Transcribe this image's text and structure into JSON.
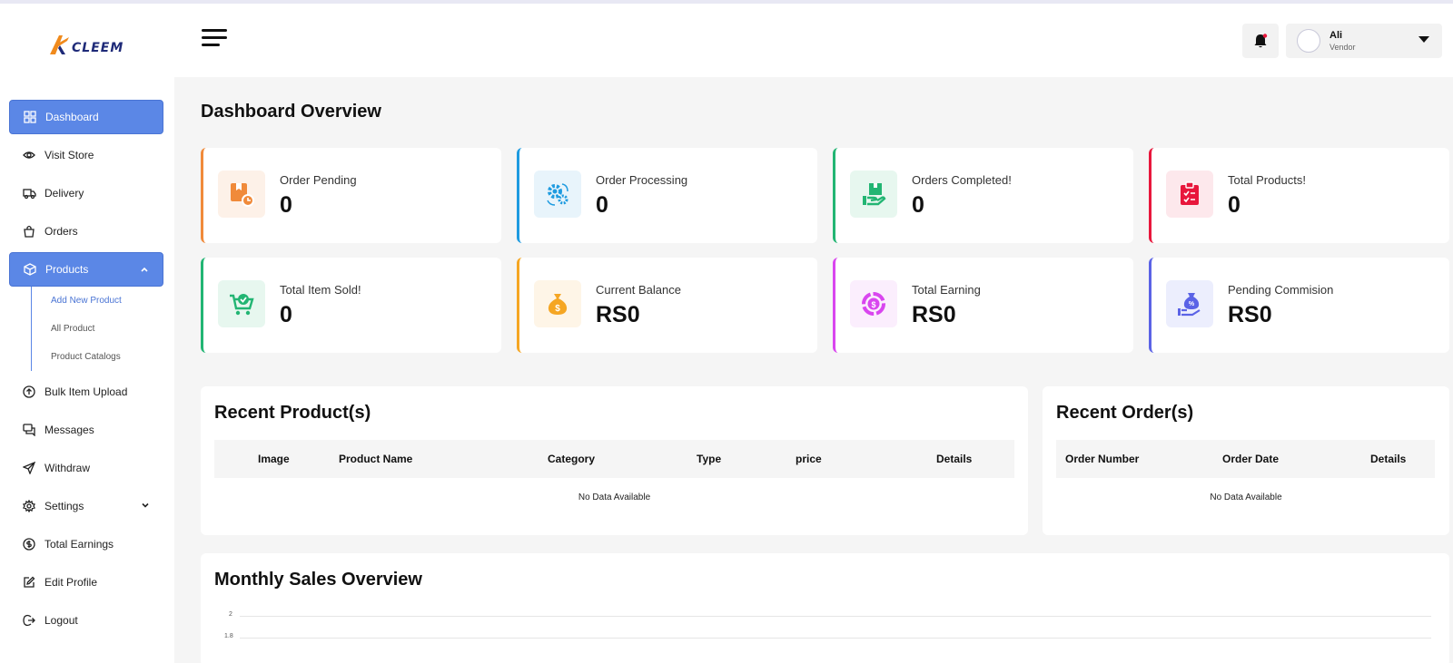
{
  "brand": {
    "logo_text": "CLEEM",
    "accent": "#5b87e6"
  },
  "sidebar": {
    "items": [
      {
        "label": "Dashboard",
        "icon": "grid-icon",
        "active": true
      },
      {
        "label": "Visit Store",
        "icon": "eye-icon"
      },
      {
        "label": "Delivery",
        "icon": "truck-icon"
      },
      {
        "label": "Orders",
        "icon": "bag-icon"
      },
      {
        "label": "Products",
        "icon": "box-icon",
        "active": true,
        "expanded": true
      },
      {
        "label": "Bulk Item Upload",
        "icon": "upload-icon"
      },
      {
        "label": "Messages",
        "icon": "chat-icon"
      },
      {
        "label": "Withdraw",
        "icon": "send-icon"
      },
      {
        "label": "Settings",
        "icon": "gear-icon"
      },
      {
        "label": "Total Earnings",
        "icon": "coin-icon"
      },
      {
        "label": "Edit Profile",
        "icon": "edit-icon"
      },
      {
        "label": "Logout",
        "icon": "logout-icon"
      }
    ],
    "products_sub": [
      {
        "label": "Add New Product",
        "active": true
      },
      {
        "label": "All Product"
      },
      {
        "label": "Product Catalogs"
      }
    ]
  },
  "header": {
    "user": {
      "name": "Ali",
      "role": "Vendor"
    }
  },
  "main": {
    "title": "Dashboard Overview",
    "cards": [
      {
        "label": "Order Pending",
        "value": "0",
        "color": "#f08a3a",
        "bg": "#fdf1e8"
      },
      {
        "label": "Order Processing",
        "value": "0",
        "color": "#1e9be0",
        "bg": "#e8f4fb"
      },
      {
        "label": "Orders Completed!",
        "value": "0",
        "color": "#22b573",
        "bg": "#e7f7ef"
      },
      {
        "label": "Total Products!",
        "value": "0",
        "color": "#e8173c",
        "bg": "#fde8ec"
      },
      {
        "label": "Total Item Sold!",
        "value": "0",
        "color": "#22b573",
        "bg": "#e7f7ef"
      },
      {
        "label": "Current Balance",
        "value": "RS0",
        "color": "#f5a623",
        "bg": "#fef5e7"
      },
      {
        "label": "Total Earning",
        "value": "RS0",
        "color": "#d946ef",
        "bg": "#fbeefd"
      },
      {
        "label": "Pending Commision",
        "value": "RS0",
        "color": "#5b63e6",
        "bg": "#eceefd"
      }
    ],
    "recent_products": {
      "title": "Recent Product(s)",
      "columns": [
        "Image",
        "Product Name",
        "Category",
        "Type",
        "price",
        "Details"
      ],
      "empty": "No Data Available"
    },
    "recent_orders": {
      "title": "Recent Order(s)",
      "columns": [
        "Order Number",
        "Order Date",
        "Details"
      ],
      "empty": "No Data Available"
    },
    "monthly": {
      "title": "Monthly Sales Overview"
    }
  },
  "chart_data": {
    "type": "line",
    "title": "Monthly Sales Overview",
    "y_ticks": [
      "2",
      "1.8"
    ],
    "grid": true
  }
}
